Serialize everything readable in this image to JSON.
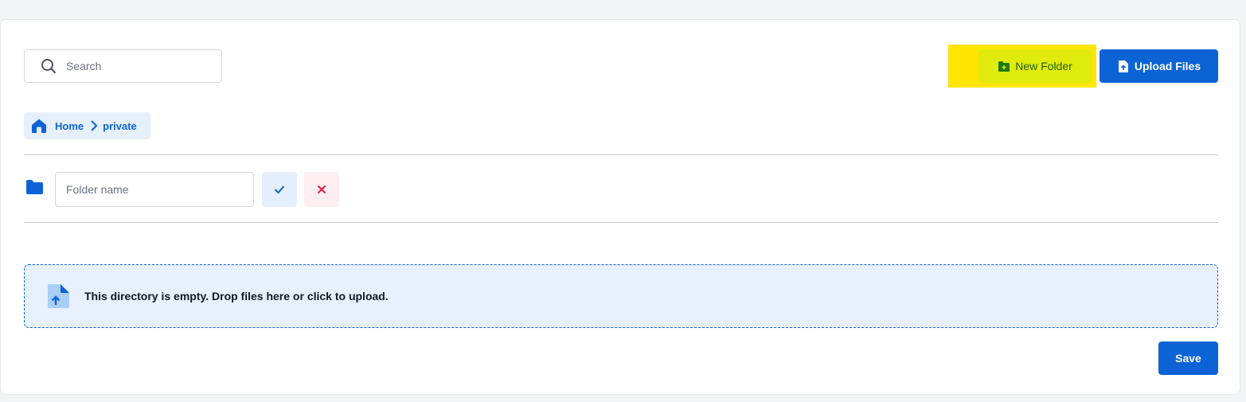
{
  "search": {
    "placeholder": "Search",
    "icon": "search-icon"
  },
  "toolbar": {
    "new_folder_label": "New Folder",
    "new_folder_icon": "folder-plus-icon",
    "upload_label": "Upload Files",
    "upload_icon": "file-upload-icon",
    "highlight_color": "#ffe600"
  },
  "breadcrumb": {
    "items": [
      {
        "label": "Home",
        "icon": "home-icon"
      },
      {
        "label": "private"
      }
    ]
  },
  "new_folder_row": {
    "icon": "folder-icon",
    "placeholder": "Folder name",
    "value": "",
    "confirm_icon": "check-icon",
    "cancel_icon": "close-icon"
  },
  "dropzone": {
    "icon": "file-upload-icon",
    "message": "This directory is empty. Drop files here or click to upload."
  },
  "footer": {
    "save_label": "Save"
  },
  "colors": {
    "primary": "#0b63d6",
    "danger": "#e11d48",
    "dropzone_bg": "#e6f1fd"
  }
}
